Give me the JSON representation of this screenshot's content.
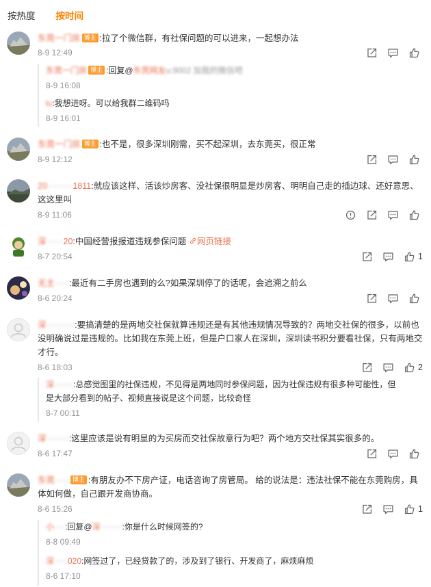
{
  "tabs": {
    "hot": "按热度",
    "time": "按时间"
  },
  "badge": "博主",
  "comments": [
    {
      "name": "东莞一门房",
      "text": ":拉了个微信群，有社保问题的可以进来，一起想办法",
      "time": "8-9 12:49",
      "like_count": "",
      "replies": [
        {
          "name": "东莞一门房",
          "text": ":回复@",
          "mention": "东莞网友",
          "mention_tail": "u:9002 加我的微信吧",
          "time": "8-9 16:08"
        },
        {
          "name": "lu",
          "text": ":我想进呀。可以给我群二维码吗",
          "time": "8-9 16:01"
        }
      ]
    },
    {
      "name": "东莞一门房",
      "text": ":也不是，很多深圳刚需，买不起深圳，去东莞买，很正常",
      "time": "8-9 12:12",
      "like_count": ""
    },
    {
      "name": "20",
      "name_tail": "1811",
      "text": ":就应该这样、活该炒房客、没社保很明显是炒房客、明明自己走的插边球、还好意思、这这里叫",
      "time": "8-9 11:06",
      "like_count": ""
    },
    {
      "name": "深",
      "name_tail": "20",
      "text": ":中国经营报报道违规参保问题",
      "link": "网页链接",
      "time": "8-7 20:54",
      "like_count": "1"
    },
    {
      "name": "无主",
      "text": ":最近有二手房也遇到的么?如果深圳停了的话呢，会追溯之前么",
      "time": "8-6 20:24",
      "like_count": ""
    },
    {
      "name": "深",
      "text": ":要搞清楚的是两地交社保就算违规还是有其他违规情况导致的？两地交社保的很多，以前也没明确说过是违规的。比如我在东莞上班，但是户口家人在深圳，深圳读书积分要看社保，只有两地交才行。",
      "time": "8-6 18:03",
      "like_count": "2",
      "replies": [
        {
          "name": "深",
          "text": ":总感觉图里的社保违规，不见得是两地同时参保问题，因为社保违规有很多种可能性，但是大部分看到的帖子、视频直接说是这个问题，比较奇怪",
          "time": "8-7 00:11"
        }
      ]
    },
    {
      "name": "深",
      "text": ":这里应该是说有明显的为买房而交社保故意行为吧？两个地方交社保其实很多的。",
      "time": "8-6 17:47",
      "like_count": ""
    },
    {
      "name": "东莞",
      "text": ":有朋友办不下房产证，电话咨询了房管局。 给的说法是：违法社保不能在东莞购房，具体如何做，自己跟开发商协商。",
      "time": "8-6 15:26",
      "like_count": "1",
      "replies": [
        {
          "name": "小",
          "text": ":回复@",
          "mention": "深",
          "mention_tail": ":你是什么时候网签的?",
          "time": "8-8 09:49"
        },
        {
          "name": "深",
          "name_tail": "020",
          "text": ":网签过了，已经贷款了的，涉及到了银行、开发商了，麻烦麻烦",
          "time": "8-6 17:10"
        }
      ]
    }
  ]
}
